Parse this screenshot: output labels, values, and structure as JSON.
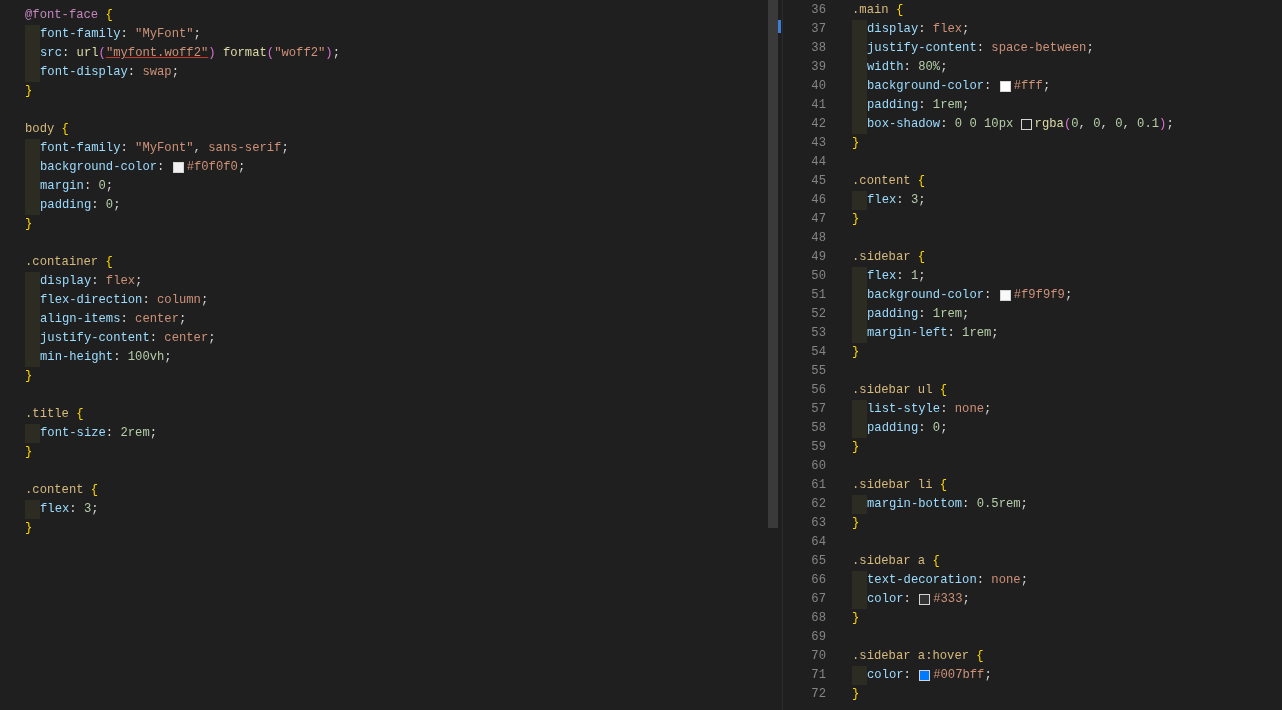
{
  "left_editor": {
    "lines": [
      {
        "kind": "code",
        "indented": false,
        "tokens": [
          {
            "kind": "atrule",
            "text": "@font-face"
          },
          {
            "kind": "brace",
            "text": "{"
          }
        ]
      },
      {
        "kind": "code",
        "indented": true,
        "tokens": [
          {
            "kind": "prop",
            "text": "font-family"
          },
          {
            "kind": "punct",
            "text": ": "
          },
          {
            "kind": "string",
            "text": "\"MyFont\""
          },
          {
            "kind": "punct",
            "text": ";"
          }
        ]
      },
      {
        "kind": "code",
        "indented": true,
        "tokens": [
          {
            "kind": "prop",
            "text": "src"
          },
          {
            "kind": "punct",
            "text": ": "
          },
          {
            "kind": "func",
            "text": "url"
          },
          {
            "kind": "paren",
            "text": "("
          },
          {
            "kind": "link",
            "text": "\"myfont.woff2\""
          },
          {
            "kind": "paren",
            "text": ")"
          },
          {
            "kind": "func",
            "text": "format"
          },
          {
            "kind": "paren",
            "text": "("
          },
          {
            "kind": "string",
            "text": "\"woff2\""
          },
          {
            "kind": "paren",
            "text": ")"
          },
          {
            "kind": "punct",
            "text": ";"
          }
        ]
      },
      {
        "kind": "code",
        "indented": true,
        "tokens": [
          {
            "kind": "prop",
            "text": "font-display"
          },
          {
            "kind": "punct",
            "text": ": "
          },
          {
            "kind": "value",
            "text": "swap"
          },
          {
            "kind": "punct",
            "text": ";"
          }
        ]
      },
      {
        "kind": "code",
        "indented": false,
        "tokens": [
          {
            "kind": "brace",
            "text": "}"
          }
        ]
      },
      {
        "kind": "blank"
      },
      {
        "kind": "code",
        "indented": false,
        "tokens": [
          {
            "kind": "selector",
            "text": "body"
          },
          {
            "kind": "brace",
            "text": "{"
          }
        ]
      },
      {
        "kind": "code",
        "indented": true,
        "tokens": [
          {
            "kind": "prop",
            "text": "font-family"
          },
          {
            "kind": "punct",
            "text": ": "
          },
          {
            "kind": "string",
            "text": "\"MyFont\""
          },
          {
            "kind": "punct",
            "text": ", "
          },
          {
            "kind": "value",
            "text": "sans-serif"
          },
          {
            "kind": "punct",
            "text": ";"
          }
        ]
      },
      {
        "kind": "code",
        "indented": true,
        "tokens": [
          {
            "kind": "prop",
            "text": "background-color"
          },
          {
            "kind": "punct",
            "text": ": "
          },
          {
            "kind": "swatch",
            "color": "#f0f0f0"
          },
          {
            "kind": "value",
            "text": "#f0f0f0"
          },
          {
            "kind": "punct",
            "text": ";"
          }
        ]
      },
      {
        "kind": "code",
        "indented": true,
        "tokens": [
          {
            "kind": "prop",
            "text": "margin"
          },
          {
            "kind": "punct",
            "text": ": "
          },
          {
            "kind": "number",
            "text": "0"
          },
          {
            "kind": "punct",
            "text": ";"
          }
        ]
      },
      {
        "kind": "code",
        "indented": true,
        "tokens": [
          {
            "kind": "prop",
            "text": "padding"
          },
          {
            "kind": "punct",
            "text": ": "
          },
          {
            "kind": "number",
            "text": "0"
          },
          {
            "kind": "punct",
            "text": ";"
          }
        ]
      },
      {
        "kind": "code",
        "indented": false,
        "tokens": [
          {
            "kind": "brace",
            "text": "}"
          }
        ]
      },
      {
        "kind": "blank"
      },
      {
        "kind": "code",
        "indented": false,
        "tokens": [
          {
            "kind": "selector",
            "text": ".container"
          },
          {
            "kind": "brace",
            "text": "{"
          }
        ]
      },
      {
        "kind": "code",
        "indented": true,
        "tokens": [
          {
            "kind": "prop",
            "text": "display"
          },
          {
            "kind": "punct",
            "text": ": "
          },
          {
            "kind": "value",
            "text": "flex"
          },
          {
            "kind": "punct",
            "text": ";"
          }
        ]
      },
      {
        "kind": "code",
        "indented": true,
        "tokens": [
          {
            "kind": "prop",
            "text": "flex-direction"
          },
          {
            "kind": "punct",
            "text": ": "
          },
          {
            "kind": "value",
            "text": "column"
          },
          {
            "kind": "punct",
            "text": ";"
          }
        ]
      },
      {
        "kind": "code",
        "indented": true,
        "tokens": [
          {
            "kind": "prop",
            "text": "align-items"
          },
          {
            "kind": "punct",
            "text": ": "
          },
          {
            "kind": "value",
            "text": "center"
          },
          {
            "kind": "punct",
            "text": ";"
          }
        ]
      },
      {
        "kind": "code",
        "indented": true,
        "tokens": [
          {
            "kind": "prop",
            "text": "justify-content"
          },
          {
            "kind": "punct",
            "text": ": "
          },
          {
            "kind": "value",
            "text": "center"
          },
          {
            "kind": "punct",
            "text": ";"
          }
        ]
      },
      {
        "kind": "code",
        "indented": true,
        "tokens": [
          {
            "kind": "prop",
            "text": "min-height"
          },
          {
            "kind": "punct",
            "text": ": "
          },
          {
            "kind": "number",
            "text": "100vh"
          },
          {
            "kind": "punct",
            "text": ";"
          }
        ]
      },
      {
        "kind": "code",
        "indented": false,
        "tokens": [
          {
            "kind": "brace",
            "text": "}"
          }
        ]
      },
      {
        "kind": "blank"
      },
      {
        "kind": "code",
        "indented": false,
        "tokens": [
          {
            "kind": "selector",
            "text": ".title"
          },
          {
            "kind": "brace",
            "text": "{"
          }
        ]
      },
      {
        "kind": "code",
        "indented": true,
        "tokens": [
          {
            "kind": "prop",
            "text": "font-size"
          },
          {
            "kind": "punct",
            "text": ": "
          },
          {
            "kind": "number",
            "text": "2rem"
          },
          {
            "kind": "punct",
            "text": ";"
          }
        ]
      },
      {
        "kind": "code",
        "indented": false,
        "tokens": [
          {
            "kind": "brace",
            "text": "}"
          }
        ]
      },
      {
        "kind": "blank"
      },
      {
        "kind": "code",
        "indented": false,
        "tokens": [
          {
            "kind": "selector",
            "text": ".content"
          },
          {
            "kind": "brace",
            "text": "{"
          }
        ]
      },
      {
        "kind": "code",
        "indented": true,
        "tokens": [
          {
            "kind": "prop",
            "text": "flex"
          },
          {
            "kind": "punct",
            "text": ": "
          },
          {
            "kind": "number",
            "text": "3"
          },
          {
            "kind": "punct",
            "text": ";"
          }
        ]
      },
      {
        "kind": "code",
        "indented": false,
        "tokens": [
          {
            "kind": "brace",
            "text": "}"
          }
        ]
      }
    ]
  },
  "right_editor": {
    "lines": [
      {
        "number": "36",
        "kind": "code",
        "indented": false,
        "tokens": [
          {
            "kind": "selector",
            "text": ".main"
          },
          {
            "kind": "brace",
            "text": "{"
          }
        ]
      },
      {
        "number": "37",
        "kind": "code",
        "indented": true,
        "tokens": [
          {
            "kind": "prop",
            "text": "display"
          },
          {
            "kind": "punct",
            "text": ": "
          },
          {
            "kind": "value",
            "text": "flex"
          },
          {
            "kind": "punct",
            "text": ";"
          }
        ]
      },
      {
        "number": "38",
        "kind": "code",
        "indented": true,
        "tokens": [
          {
            "kind": "prop",
            "text": "justify-content"
          },
          {
            "kind": "punct",
            "text": ": "
          },
          {
            "kind": "value",
            "text": "space-between"
          },
          {
            "kind": "punct",
            "text": ";"
          }
        ]
      },
      {
        "number": "39",
        "kind": "code",
        "indented": true,
        "tokens": [
          {
            "kind": "prop",
            "text": "width"
          },
          {
            "kind": "punct",
            "text": ": "
          },
          {
            "kind": "number",
            "text": "80%"
          },
          {
            "kind": "punct",
            "text": ";"
          }
        ]
      },
      {
        "number": "40",
        "kind": "code",
        "indented": true,
        "tokens": [
          {
            "kind": "prop",
            "text": "background-color"
          },
          {
            "kind": "punct",
            "text": ": "
          },
          {
            "kind": "swatch",
            "color": "#ffffff"
          },
          {
            "kind": "value",
            "text": "#fff"
          },
          {
            "kind": "punct",
            "text": ";"
          }
        ]
      },
      {
        "number": "41",
        "kind": "code",
        "indented": true,
        "tokens": [
          {
            "kind": "prop",
            "text": "padding"
          },
          {
            "kind": "punct",
            "text": ": "
          },
          {
            "kind": "number",
            "text": "1rem"
          },
          {
            "kind": "punct",
            "text": ";"
          }
        ]
      },
      {
        "number": "42",
        "kind": "code",
        "indented": true,
        "tokens": [
          {
            "kind": "prop",
            "text": "box-shadow"
          },
          {
            "kind": "punct",
            "text": ": "
          },
          {
            "kind": "number",
            "text": "0 0 10px"
          },
          {
            "kind": "swatch",
            "color": "#1f1f1f"
          },
          {
            "kind": "func",
            "text": "rgba"
          },
          {
            "kind": "paren",
            "text": "("
          },
          {
            "kind": "number",
            "text": "0"
          },
          {
            "kind": "punct",
            "text": ", "
          },
          {
            "kind": "number",
            "text": "0"
          },
          {
            "kind": "punct",
            "text": ", "
          },
          {
            "kind": "number",
            "text": "0"
          },
          {
            "kind": "punct",
            "text": ", "
          },
          {
            "kind": "number",
            "text": "0.1"
          },
          {
            "kind": "paren",
            "text": ")"
          },
          {
            "kind": "punct",
            "text": ";"
          }
        ]
      },
      {
        "number": "43",
        "kind": "code",
        "indented": false,
        "tokens": [
          {
            "kind": "brace",
            "text": "}"
          }
        ]
      },
      {
        "number": "44",
        "kind": "blank"
      },
      {
        "number": "45",
        "kind": "code",
        "indented": false,
        "tokens": [
          {
            "kind": "selector",
            "text": ".content"
          },
          {
            "kind": "brace",
            "text": "{"
          }
        ]
      },
      {
        "number": "46",
        "kind": "code",
        "indented": true,
        "tokens": [
          {
            "kind": "prop",
            "text": "flex"
          },
          {
            "kind": "punct",
            "text": ": "
          },
          {
            "kind": "number",
            "text": "3"
          },
          {
            "kind": "punct",
            "text": ";"
          }
        ]
      },
      {
        "number": "47",
        "kind": "code",
        "indented": false,
        "tokens": [
          {
            "kind": "brace",
            "text": "}"
          }
        ]
      },
      {
        "number": "48",
        "kind": "blank"
      },
      {
        "number": "49",
        "kind": "code",
        "indented": false,
        "tokens": [
          {
            "kind": "selector",
            "text": ".sidebar"
          },
          {
            "kind": "brace",
            "text": "{"
          }
        ]
      },
      {
        "number": "50",
        "kind": "code",
        "indented": true,
        "tokens": [
          {
            "kind": "prop",
            "text": "flex"
          },
          {
            "kind": "punct",
            "text": ": "
          },
          {
            "kind": "number",
            "text": "1"
          },
          {
            "kind": "punct",
            "text": ";"
          }
        ]
      },
      {
        "number": "51",
        "kind": "code",
        "indented": true,
        "tokens": [
          {
            "kind": "prop",
            "text": "background-color"
          },
          {
            "kind": "punct",
            "text": ": "
          },
          {
            "kind": "swatch",
            "color": "#f9f9f9"
          },
          {
            "kind": "value",
            "text": "#f9f9f9"
          },
          {
            "kind": "punct",
            "text": ";"
          }
        ]
      },
      {
        "number": "52",
        "kind": "code",
        "indented": true,
        "tokens": [
          {
            "kind": "prop",
            "text": "padding"
          },
          {
            "kind": "punct",
            "text": ": "
          },
          {
            "kind": "number",
            "text": "1rem"
          },
          {
            "kind": "punct",
            "text": ";"
          }
        ]
      },
      {
        "number": "53",
        "kind": "code",
        "indented": true,
        "tokens": [
          {
            "kind": "prop",
            "text": "margin-left"
          },
          {
            "kind": "punct",
            "text": ": "
          },
          {
            "kind": "number",
            "text": "1rem"
          },
          {
            "kind": "punct",
            "text": ";"
          }
        ]
      },
      {
        "number": "54",
        "kind": "code",
        "indented": false,
        "tokens": [
          {
            "kind": "brace",
            "text": "}"
          }
        ]
      },
      {
        "number": "55",
        "kind": "blank"
      },
      {
        "number": "56",
        "kind": "code",
        "indented": false,
        "tokens": [
          {
            "kind": "selector",
            "text": ".sidebar ul"
          },
          {
            "kind": "brace",
            "text": "{"
          }
        ]
      },
      {
        "number": "57",
        "kind": "code",
        "indented": true,
        "tokens": [
          {
            "kind": "prop",
            "text": "list-style"
          },
          {
            "kind": "punct",
            "text": ": "
          },
          {
            "kind": "value",
            "text": "none"
          },
          {
            "kind": "punct",
            "text": ";"
          }
        ]
      },
      {
        "number": "58",
        "kind": "code",
        "indented": true,
        "tokens": [
          {
            "kind": "prop",
            "text": "padding"
          },
          {
            "kind": "punct",
            "text": ": "
          },
          {
            "kind": "number",
            "text": "0"
          },
          {
            "kind": "punct",
            "text": ";"
          }
        ]
      },
      {
        "number": "59",
        "kind": "code",
        "indented": false,
        "tokens": [
          {
            "kind": "brace",
            "text": "}"
          }
        ]
      },
      {
        "number": "60",
        "kind": "blank"
      },
      {
        "number": "61",
        "kind": "code",
        "indented": false,
        "tokens": [
          {
            "kind": "selector",
            "text": ".sidebar li"
          },
          {
            "kind": "brace",
            "text": "{"
          }
        ]
      },
      {
        "number": "62",
        "kind": "code",
        "indented": true,
        "tokens": [
          {
            "kind": "prop",
            "text": "margin-bottom"
          },
          {
            "kind": "punct",
            "text": ": "
          },
          {
            "kind": "number",
            "text": "0.5rem"
          },
          {
            "kind": "punct",
            "text": ";"
          }
        ]
      },
      {
        "number": "63",
        "kind": "code",
        "indented": false,
        "tokens": [
          {
            "kind": "brace",
            "text": "}"
          }
        ]
      },
      {
        "number": "64",
        "kind": "blank"
      },
      {
        "number": "65",
        "kind": "code",
        "indented": false,
        "tokens": [
          {
            "kind": "selector",
            "text": ".sidebar a"
          },
          {
            "kind": "brace",
            "text": "{"
          }
        ]
      },
      {
        "number": "66",
        "kind": "code",
        "indented": true,
        "tokens": [
          {
            "kind": "prop",
            "text": "text-decoration"
          },
          {
            "kind": "punct",
            "text": ": "
          },
          {
            "kind": "value",
            "text": "none"
          },
          {
            "kind": "punct",
            "text": ";"
          }
        ]
      },
      {
        "number": "67",
        "kind": "code",
        "indented": true,
        "tokens": [
          {
            "kind": "prop",
            "text": "color"
          },
          {
            "kind": "punct",
            "text": ": "
          },
          {
            "kind": "swatch",
            "color": "#333333"
          },
          {
            "kind": "value",
            "text": "#333"
          },
          {
            "kind": "punct",
            "text": ";"
          }
        ]
      },
      {
        "number": "68",
        "kind": "code",
        "indented": false,
        "tokens": [
          {
            "kind": "brace",
            "text": "}"
          }
        ]
      },
      {
        "number": "69",
        "kind": "blank"
      },
      {
        "number": "70",
        "kind": "code",
        "indented": false,
        "tokens": [
          {
            "kind": "selector",
            "text": ".sidebar a:hover"
          },
          {
            "kind": "brace",
            "text": "{"
          }
        ]
      },
      {
        "number": "71",
        "kind": "code",
        "indented": true,
        "tokens": [
          {
            "kind": "prop",
            "text": "color"
          },
          {
            "kind": "punct",
            "text": ": "
          },
          {
            "kind": "swatch",
            "color": "#007bff"
          },
          {
            "kind": "value",
            "text": "#007bff"
          },
          {
            "kind": "punct",
            "text": ";"
          }
        ]
      },
      {
        "number": "72",
        "kind": "code",
        "indented": false,
        "tokens": [
          {
            "kind": "brace",
            "text": "}"
          }
        ]
      }
    ]
  }
}
